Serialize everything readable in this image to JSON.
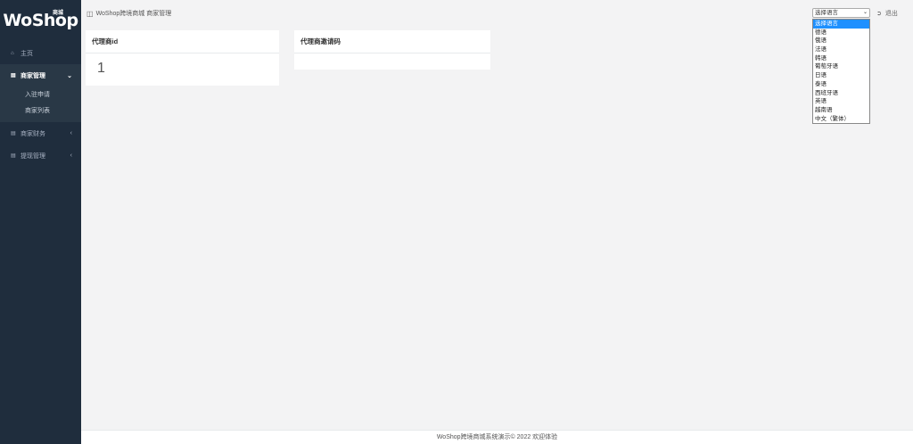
{
  "sidebar": {
    "logo": "WoShop",
    "logo_sub": "商城",
    "items": [
      {
        "label": "主页"
      },
      {
        "label": "商家管理",
        "sub": [
          "入驻申请",
          "商家列表"
        ]
      },
      {
        "label": "商家财务"
      },
      {
        "label": "提现管理"
      }
    ]
  },
  "header": {
    "breadcrumb": "WoShop跨境商城  商家管理",
    "language_select": "选择语言",
    "logout": "退出"
  },
  "language_options": [
    "选择语言",
    "德语",
    "俄语",
    "法语",
    "韩语",
    "葡萄牙语",
    "日语",
    "泰语",
    "西班牙语",
    "英语",
    "越南语",
    "中文（繁体）"
  ],
  "cards": [
    {
      "title": "代理商id",
      "value": "1"
    },
    {
      "title": "代理商邀请码",
      "value": ""
    }
  ],
  "footer": "WoShop跨境商城系统演示© 2022 欢迎体验",
  "colors": {
    "sidebar": "#1f2d3d",
    "sidebar_active": "#293846",
    "selected_option": "#1e90ff"
  }
}
